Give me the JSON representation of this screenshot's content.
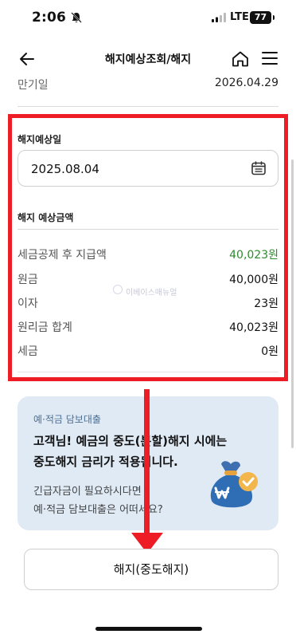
{
  "status_bar": {
    "time": "2:06",
    "network": "LTE",
    "battery": "77"
  },
  "header": {
    "title": "해지예상조회/해지"
  },
  "maturity": {
    "label": "만기일",
    "value": "2026.04.29"
  },
  "expected_date": {
    "label": "해지예상일",
    "value": "2025.08.04"
  },
  "amounts": {
    "label": "해지 예상금액",
    "rows": [
      {
        "label": "세금공제 후 지급액",
        "value": "40,023원"
      },
      {
        "label": "원금",
        "value": "40,000원"
      },
      {
        "label": "이자",
        "value": "23원"
      },
      {
        "label": "원리금 합계",
        "value": "40,023원"
      },
      {
        "label": "세금",
        "value": "0원"
      }
    ]
  },
  "watermark": "이베이스매뉴얼",
  "promo": {
    "tag": "예·적금 담보대출",
    "title_line1": "고객님! 예금의 중도(분할)해지 시에는",
    "title_line2": "중도해지 금리가 적용됩니다.",
    "desc_line1": "긴급자금이 필요하시다면",
    "desc_line2": "예·적금 담보대출은 어떠세요?"
  },
  "cancel_button": {
    "label": "해지(중도해지)"
  },
  "colors": {
    "highlight": "#ee1c24",
    "positive_amount": "#2e8b2e",
    "promo_bg": "#dfeaf5"
  }
}
